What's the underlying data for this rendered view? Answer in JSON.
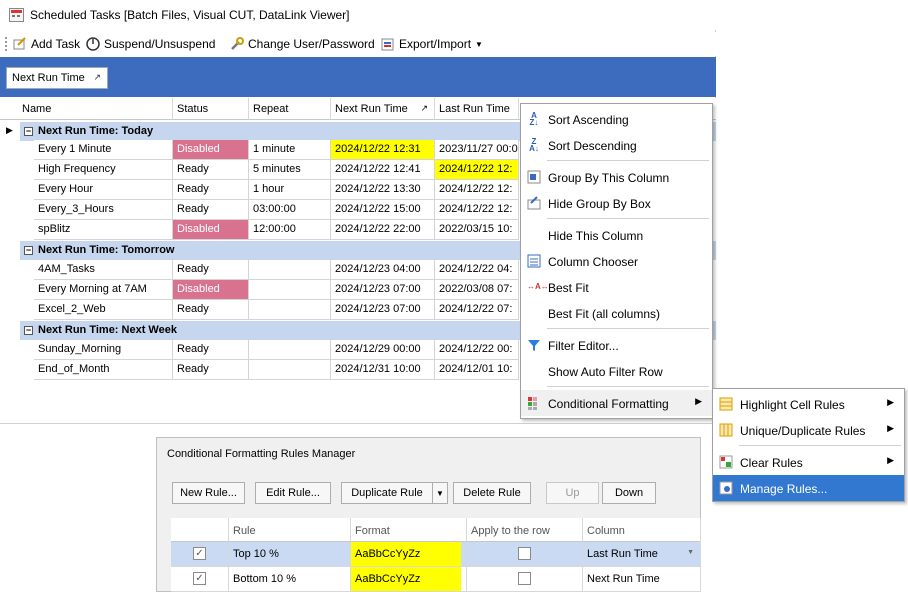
{
  "window": {
    "title": "Scheduled Tasks [Batch Files, Visual CUT, DataLink Viewer]"
  },
  "toolbar": {
    "add_task": "Add Task",
    "suspend": "Suspend/Unsuspend",
    "change_user": "Change User/Password",
    "export_import": "Export/Import"
  },
  "group_panel": {
    "chip": "Next Run Time"
  },
  "grid": {
    "headers": [
      "Name",
      "Status",
      "Repeat",
      "Next Run Time",
      "Last Run Time"
    ],
    "groups": [
      {
        "label": "Next Run Time: Today",
        "rows": [
          {
            "name": "Every 1 Minute",
            "status": "Disabled",
            "repeat": "1 minute",
            "next": "2024/12/22  12:31",
            "last": "2023/11/27  00:0"
          },
          {
            "name": "High Frequency",
            "status": "Ready",
            "repeat": "5 minutes",
            "next": "2024/12/22  12:41",
            "last": "2024/12/22  12:"
          },
          {
            "name": "Every Hour",
            "status": "Ready",
            "repeat": "1 hour",
            "next": "2024/12/22  13:30",
            "last": "2024/12/22  12:"
          },
          {
            "name": "Every_3_Hours",
            "status": "Ready",
            "repeat": "03:00:00",
            "next": "2024/12/22  15:00",
            "last": "2024/12/22  12:"
          },
          {
            "name": "spBlitz",
            "status": "Disabled",
            "repeat": "12:00:00",
            "next": "2024/12/22  22:00",
            "last": "2022/03/15  10:"
          }
        ]
      },
      {
        "label": "Next Run Time: Tomorrow",
        "rows": [
          {
            "name": "4AM_Tasks",
            "status": "Ready",
            "repeat": "",
            "next": "2024/12/23  04:00",
            "last": "2024/12/22  04:"
          },
          {
            "name": "Every Morning at 7AM",
            "status": "Disabled",
            "repeat": "",
            "next": "2024/12/23  07:00",
            "last": "2022/03/08  07:"
          },
          {
            "name": "Excel_2_Web",
            "status": "Ready",
            "repeat": "",
            "next": "2024/12/23  07:00",
            "last": "2024/12/22  07:"
          }
        ]
      },
      {
        "label": "Next Run Time: Next Week",
        "rows": [
          {
            "name": "Sunday_Morning",
            "status": "Ready",
            "repeat": "",
            "next": "2024/12/29  00:00",
            "last": "2024/12/22  00:"
          },
          {
            "name": "End_of_Month",
            "status": "Ready",
            "repeat": "",
            "next": "2024/12/31  10:00",
            "last": "2024/12/01  10:"
          }
        ]
      }
    ]
  },
  "context_menu": {
    "items": [
      "Sort Ascending",
      "Sort Descending",
      "Group By This Column",
      "Hide Group By Box",
      "Hide This Column",
      "Column Chooser",
      "Best Fit",
      "Best Fit (all columns)",
      "Filter Editor...",
      "Show Auto Filter Row",
      "Conditional Formatting"
    ]
  },
  "submenu": {
    "items": [
      "Highlight Cell Rules",
      "Unique/Duplicate Rules",
      "Clear Rules",
      "Manage Rules..."
    ]
  },
  "dialog": {
    "title": "Conditional Formatting Rules Manager",
    "buttons": {
      "new_rule": "New Rule...",
      "edit_rule": "Edit Rule...",
      "duplicate_rule": "Duplicate Rule",
      "delete_rule": "Delete Rule",
      "up": "Up",
      "down": "Down"
    },
    "headers": [
      "Rule",
      "Format",
      "Apply to the row",
      "Column"
    ],
    "rows": [
      {
        "rule": "Top 10 %",
        "format": "AaBbCcYyZz",
        "column": "Last Run Time"
      },
      {
        "rule": "Bottom 10 %",
        "format": "AaBbCcYyZz",
        "column": "Next Run Time"
      }
    ]
  },
  "colors": {
    "group_bar": "#3d6bbd",
    "disabled": "#d9728f",
    "highlight": "#ffff00",
    "menu_highlight": "#3378d0"
  }
}
